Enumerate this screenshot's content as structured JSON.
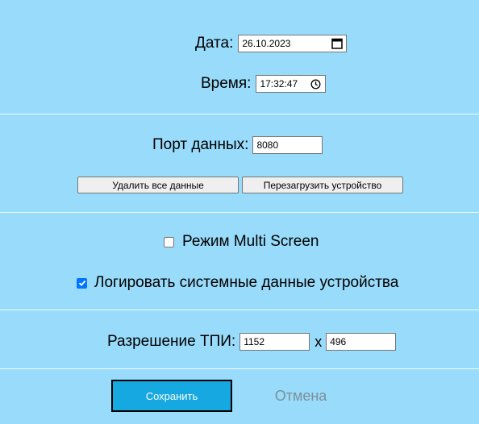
{
  "datetime": {
    "date_label": "Дата:",
    "date_value": "26.10.2023",
    "time_label": "Время:",
    "time_value": "17:32:47"
  },
  "port": {
    "label": "Порт данных:",
    "value": "8080"
  },
  "actions": {
    "delete_all_label": "Удалить все данные",
    "reboot_label": "Перезагрузить устройство"
  },
  "options": {
    "multi_screen_label": "Режим Multi Screen",
    "multi_screen_checked": false,
    "log_system_label": "Логировать системные данные устройства",
    "log_system_checked": true
  },
  "resolution": {
    "label": "Разрешение ТПИ:",
    "width": "1152",
    "separator": "x",
    "height": "496"
  },
  "footer": {
    "save_label": "Сохранить",
    "cancel_label": "Отмена"
  },
  "colors": {
    "background": "#99dbfa",
    "save_button": "#16a8e0",
    "checkbox_accent": "#0075ff",
    "cancel_text": "#7d8f99"
  },
  "icons": {
    "date": "calendar-icon",
    "time": "clock-icon",
    "check": "checkmark-icon"
  }
}
